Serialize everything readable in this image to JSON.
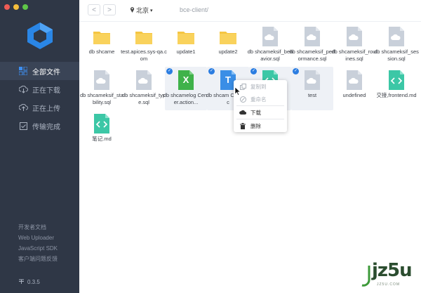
{
  "window": {
    "traffic_colors": [
      "#ee5b55",
      "#f4be3b",
      "#5fc648"
    ]
  },
  "sidebar": {
    "items": [
      {
        "label": "全部文件",
        "icon": "grid-icon",
        "active": true
      },
      {
        "label": "正在下载",
        "icon": "cloud-download-icon",
        "active": false
      },
      {
        "label": "正在上传",
        "icon": "cloud-upload-icon",
        "active": false
      },
      {
        "label": "传输完成",
        "icon": "check-box-icon",
        "active": false
      }
    ],
    "links": [
      "开发者文档",
      "Web Uploader",
      "JavaScript SDK",
      "客户端问题反馈"
    ],
    "version": "0.3.5"
  },
  "toolbar": {
    "back": "<",
    "forward": ">",
    "region": "北京",
    "path": "bce-client/"
  },
  "files": [
    {
      "name": "db shcame",
      "type": "folder",
      "selected": false
    },
    {
      "name": "test.apices.sys-qa.com",
      "type": "folder",
      "selected": false
    },
    {
      "name": "update1",
      "type": "folder",
      "selected": false
    },
    {
      "name": "update2",
      "type": "folder",
      "selected": false
    },
    {
      "name": "db shcameksif_behavior.sql",
      "type": "cloud",
      "selected": false
    },
    {
      "name": "db shcameksif_performance.sql",
      "type": "cloud",
      "selected": false
    },
    {
      "name": "db shcameksif_routines.sql",
      "type": "cloud",
      "selected": false
    },
    {
      "name": "db shcameksif_session.sql",
      "type": "cloud",
      "selected": false
    },
    {
      "name": "db shcameksif_stability.sql",
      "type": "cloud",
      "selected": false
    },
    {
      "name": "db shcameksif_type.sql",
      "type": "cloud",
      "selected": false
    },
    {
      "name": "db shcamelog Center.action...",
      "type": "excel",
      "letter": "X",
      "selected": true
    },
    {
      "name": "db shcam Center.sc",
      "type": "text",
      "letter": "T",
      "selected": true
    },
    {
      "name": "",
      "type": "code",
      "selected": true
    },
    {
      "name": "test",
      "type": "cloud",
      "selected": true
    },
    {
      "name": "undefined",
      "type": "cloud",
      "selected": false
    },
    {
      "name": "交接,frontend.md",
      "type": "code",
      "selected": false
    },
    {
      "name": "笔记.md",
      "type": "code",
      "selected": false
    }
  ],
  "context_menu": {
    "items": [
      {
        "label": "复制到",
        "icon": "copy-icon",
        "disabled": true
      },
      {
        "label": "重命名",
        "icon": "rename-icon",
        "disabled": true
      },
      {
        "label": "下载",
        "icon": "cloud-download-icon",
        "disabled": false
      },
      {
        "label": "删除",
        "icon": "trash-icon",
        "disabled": false
      }
    ]
  },
  "watermark": {
    "text": "jz5u",
    "sub": "JZ5U.COM"
  }
}
